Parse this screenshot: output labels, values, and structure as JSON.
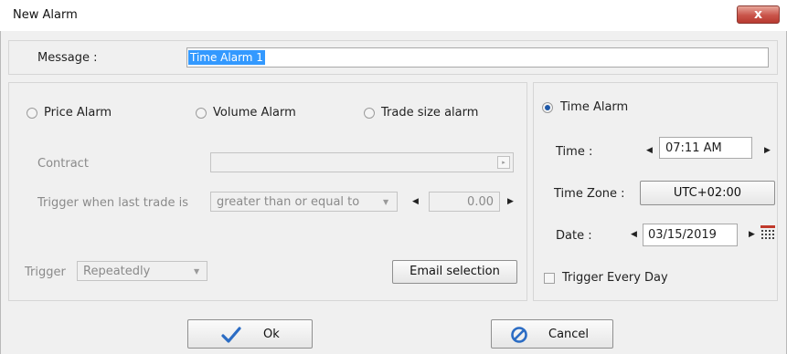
{
  "window": {
    "title": "New Alarm",
    "close_glyph": "x"
  },
  "message": {
    "label": "Message :",
    "value": "Time Alarm 1"
  },
  "alarm_types": {
    "price": "Price Alarm",
    "volume": "Volume Alarm",
    "trade_size": "Trade size alarm",
    "time": "Time Alarm"
  },
  "contract": {
    "label": "Contract",
    "value": ""
  },
  "trigger_when": {
    "label": "Trigger when last trade is",
    "operator": "greater than or equal to",
    "value": "0.00"
  },
  "trigger": {
    "label": "Trigger",
    "value": "Repeatedly"
  },
  "email_button": "Email selection",
  "time_alarm": {
    "time_label": "Time :",
    "time_value": "07:11 AM",
    "timezone_label": "Time Zone :",
    "timezone_value": "UTC+02:00",
    "date_label": "Date :",
    "date_value": "03/15/2019",
    "trigger_every_day": "Trigger Every Day"
  },
  "buttons": {
    "ok": "Ok",
    "cancel": "Cancel"
  },
  "icons": {
    "ok": "checkmark-icon",
    "cancel": "no-entry-icon",
    "calendar": "calendar-icon"
  }
}
